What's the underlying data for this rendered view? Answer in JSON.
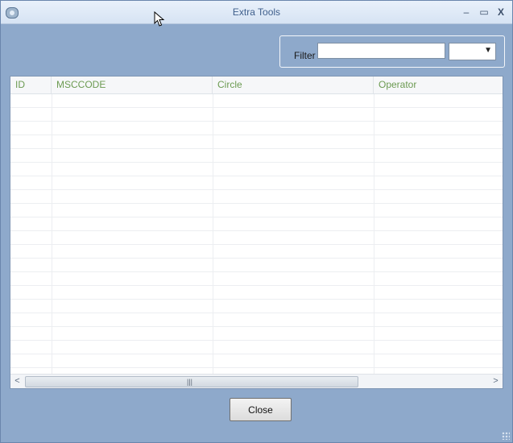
{
  "window": {
    "title": "Extra Tools",
    "controls": {
      "minimize": "–",
      "maximize": "▭",
      "close": "X"
    }
  },
  "filter": {
    "label": "Filter",
    "input_value": "",
    "select_value": ""
  },
  "grid": {
    "columns": [
      "ID",
      "MSCCODE",
      "Circle",
      "Operator"
    ],
    "rows": []
  },
  "footer": {
    "close_label": "Close"
  },
  "colors": {
    "background": "#8ea9cb",
    "header_text": "#6c9b52",
    "title_text": "#3f5f8c"
  }
}
